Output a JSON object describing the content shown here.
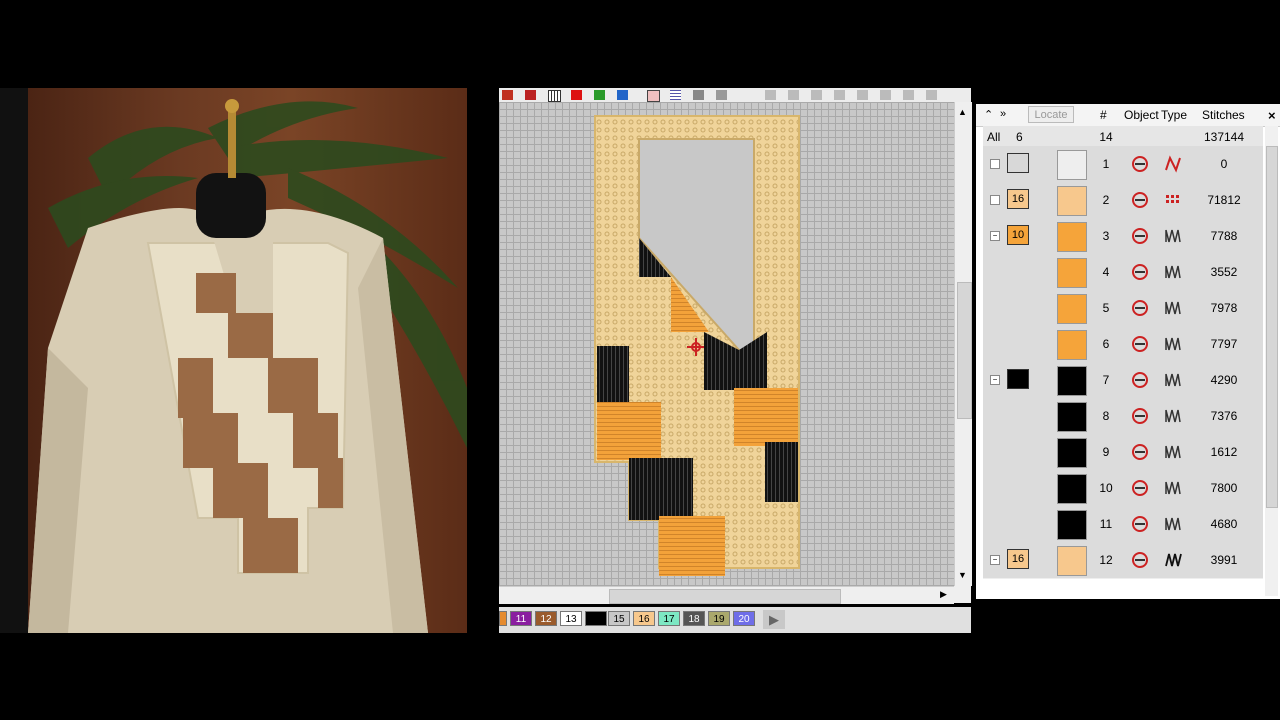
{
  "palette": {
    "swatches": [
      {
        "label": "",
        "color": "#e58b2f",
        "fg": "#000"
      },
      {
        "label": "11",
        "color": "#8a1ea0",
        "fg": "#fff"
      },
      {
        "label": "12",
        "color": "#9a5b2c",
        "fg": "#fff"
      },
      {
        "label": "13",
        "color": "#ffffff",
        "fg": "#000"
      },
      {
        "label": "",
        "color": "#000000",
        "fg": "#fff"
      },
      {
        "label": "15",
        "color": "#c7c7c7",
        "fg": "#000"
      },
      {
        "label": "16",
        "color": "#f7c88d",
        "fg": "#000"
      },
      {
        "label": "17",
        "color": "#7de8c4",
        "fg": "#000"
      },
      {
        "label": "18",
        "color": "#555555",
        "fg": "#fff"
      },
      {
        "label": "19",
        "color": "#aaa86c",
        "fg": "#000"
      },
      {
        "label": "20",
        "color": "#6f6ee8",
        "fg": "#fff"
      }
    ]
  },
  "objlist": {
    "locate_label": "Locate",
    "col_num": "#",
    "col_object": "Object",
    "col_type": "Type",
    "col_stitches": "Stitches",
    "close_label": "×",
    "summary": {
      "all": "All",
      "count": "6",
      "num": "14",
      "stitches": "137144"
    },
    "rows": [
      {
        "num": "1",
        "stitches": "0",
        "color_label": "",
        "box_color": "#d8d8d8",
        "expand": "□",
        "thumb": "#eeeeee",
        "type": "line"
      },
      {
        "num": "2",
        "stitches": "71812",
        "color_label": "16",
        "box_color": "#f7c88d",
        "expand": "□",
        "thumb": "#f7c88d",
        "type": "fill"
      },
      {
        "num": "3",
        "stitches": "7788",
        "color_label": "10",
        "box_color": "#f5a43a",
        "expand": "−",
        "thumb": "#f5a43a",
        "type": "satin"
      },
      {
        "num": "4",
        "stitches": "3552",
        "color_label": "",
        "box_color": "",
        "expand": "",
        "thumb": "#f5a43a",
        "type": "satin"
      },
      {
        "num": "5",
        "stitches": "7978",
        "color_label": "",
        "box_color": "",
        "expand": "",
        "thumb": "#f5a43a",
        "type": "satin"
      },
      {
        "num": "6",
        "stitches": "7797",
        "color_label": "",
        "box_color": "",
        "expand": "",
        "thumb": "#f5a43a",
        "type": "satin"
      },
      {
        "num": "7",
        "stitches": "4290",
        "color_label": "",
        "box_color": "#000000",
        "expand": "−",
        "thumb": "#000000",
        "type": "satin"
      },
      {
        "num": "8",
        "stitches": "7376",
        "color_label": "",
        "box_color": "",
        "expand": "",
        "thumb": "#000000",
        "type": "satin"
      },
      {
        "num": "9",
        "stitches": "1612",
        "color_label": "",
        "box_color": "",
        "expand": "",
        "thumb": "#000000",
        "type": "satin"
      },
      {
        "num": "10",
        "stitches": "7800",
        "color_label": "",
        "box_color": "",
        "expand": "",
        "thumb": "#000000",
        "type": "satin"
      },
      {
        "num": "11",
        "stitches": "4680",
        "color_label": "",
        "box_color": "",
        "expand": "",
        "thumb": "#000000",
        "type": "satin"
      },
      {
        "num": "12",
        "stitches": "3991",
        "color_label": "16",
        "box_color": "#f7c88d",
        "expand": "−",
        "thumb": "#f7c88d",
        "type": "zig"
      }
    ]
  }
}
